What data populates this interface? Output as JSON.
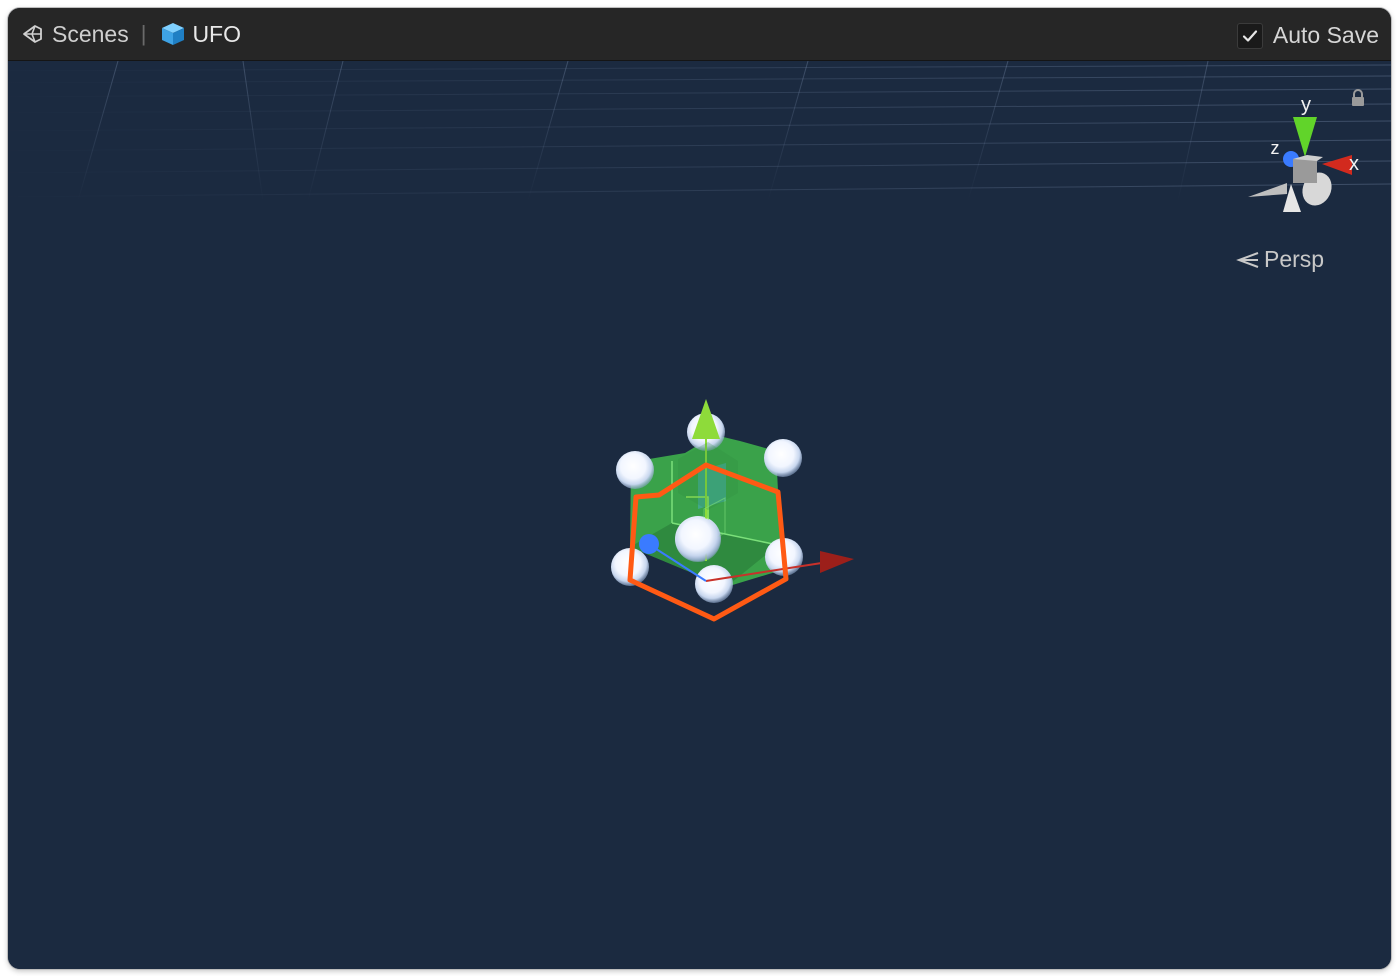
{
  "toolbar": {
    "scenes_label": "Scenes",
    "prefab_label": "UFO",
    "auto_save_label": "Auto Save",
    "auto_save_checked": true
  },
  "scene_view": {
    "projection_label": "Persp",
    "orientation_gizmo": {
      "x_label": "x",
      "y_label": "y",
      "z_label": "z"
    }
  },
  "colors": {
    "viewport_bg": "#1b2a40",
    "toolbar_bg": "#262626",
    "selection_outline": "#ff5a14",
    "object_fill": "#3aa24a",
    "axis_x": "#d22a1e",
    "axis_y": "#8edb3a",
    "axis_z": "#3a7bff"
  },
  "icons": {
    "scenes": "unity-logo-icon",
    "prefab": "prefab-cube-icon",
    "checkbox": "checkmark-icon",
    "lock": "lock-icon",
    "perspective": "perspective-icon"
  }
}
